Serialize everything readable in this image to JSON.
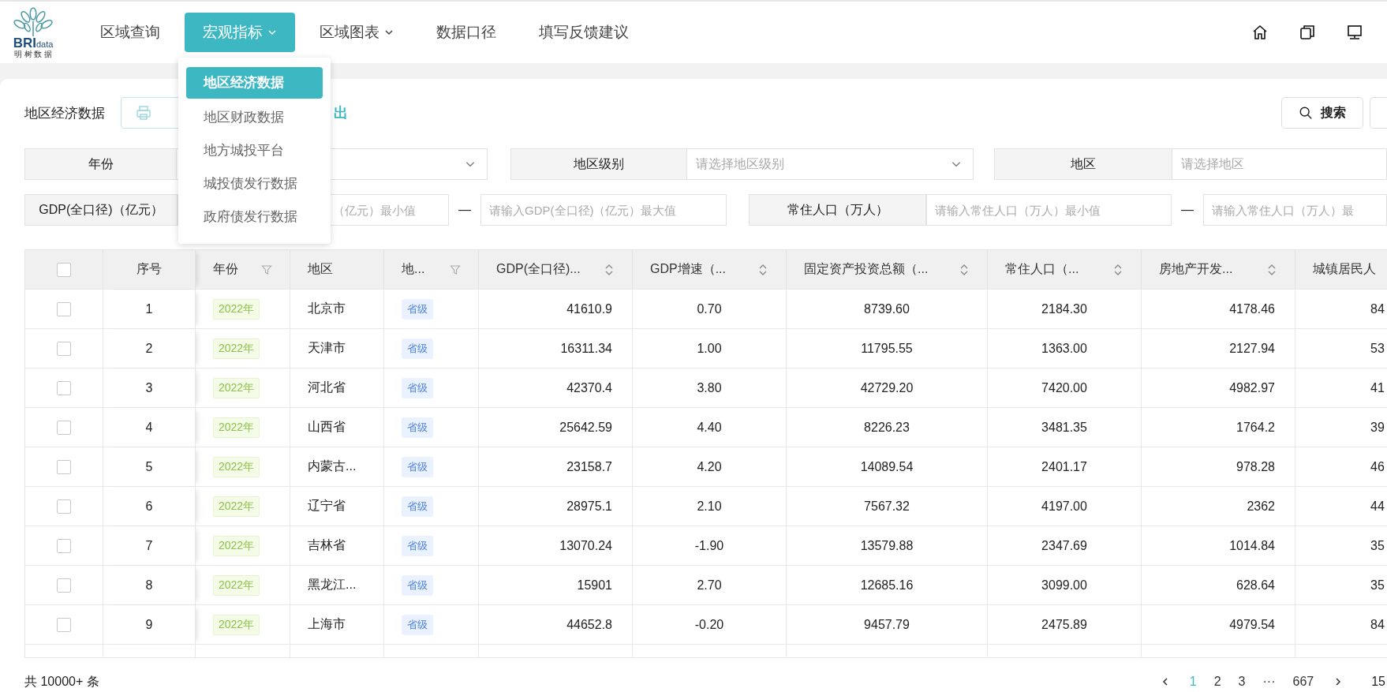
{
  "logo": {
    "mark": "BRI",
    "suffix": "data",
    "tagline": "明 树 数 据"
  },
  "nav": {
    "items": [
      {
        "label": "区域查询",
        "selected": false,
        "caret": false
      },
      {
        "label": "宏观指标",
        "selected": true,
        "caret": true
      },
      {
        "label": "区域图表",
        "selected": false,
        "caret": true
      },
      {
        "label": "数据口径",
        "selected": false,
        "caret": false
      },
      {
        "label": "填写反馈建议",
        "selected": false,
        "caret": false
      }
    ]
  },
  "dropdown": {
    "items": [
      {
        "label": "地区经济数据",
        "selected": true
      },
      {
        "label": "地区财政数据",
        "selected": false
      },
      {
        "label": "地方城投平台",
        "selected": false
      },
      {
        "label": "城投债发行数据",
        "selected": false
      },
      {
        "label": "政府债发行数据",
        "selected": false
      }
    ]
  },
  "toolbar": {
    "title": "地区经济数据",
    "export_label": "出",
    "search_label": "搜索"
  },
  "filters": {
    "year_label": "年份",
    "level_label": "地区级别",
    "level_placeholder": "请选择地区级别",
    "region_label": "地区",
    "region_placeholder": "请选择地区",
    "gdp_label": "GDP(全口径)（亿元）",
    "gdp_min_placeholder": "（亿元）最小值",
    "gdp_max_placeholder": "请输入GDP(全口径)（亿元）最大值",
    "pop_label": "常住人口（万人）",
    "pop_min_placeholder": "请输入常住人口（万人）最小值",
    "pop_max_placeholder": "请输入常住人口（万人）最",
    "dash": "—"
  },
  "table": {
    "header_checked": false,
    "columns": [
      {
        "label": "序号",
        "kind": "plain"
      },
      {
        "label": "年份",
        "kind": "filterable"
      },
      {
        "label": "地区",
        "kind": "plain"
      },
      {
        "label": "地...",
        "kind": "filterable"
      },
      {
        "label": "GDP(全口径)...",
        "kind": "sortable"
      },
      {
        "label": "GDP增速（...",
        "kind": "sortable"
      },
      {
        "label": "固定资产投资总额（...",
        "kind": "sortable"
      },
      {
        "label": "常住人口（...",
        "kind": "sortable"
      },
      {
        "label": "房地产开发...",
        "kind": "sortable"
      },
      {
        "label": "城镇居民人",
        "kind": "plain"
      }
    ],
    "rows": [
      {
        "checked": false,
        "cells": [
          "1",
          "2022年",
          "北京市",
          "省级",
          "41610.9",
          "0.70",
          "8739.60",
          "2184.30",
          "4178.46",
          "84"
        ]
      },
      {
        "checked": false,
        "cells": [
          "2",
          "2022年",
          "天津市",
          "省级",
          "16311.34",
          "1.00",
          "11795.55",
          "1363.00",
          "2127.94",
          "53"
        ]
      },
      {
        "checked": false,
        "cells": [
          "3",
          "2022年",
          "河北省",
          "省级",
          "42370.4",
          "3.80",
          "42729.20",
          "7420.00",
          "4982.97",
          "41"
        ]
      },
      {
        "checked": false,
        "cells": [
          "4",
          "2022年",
          "山西省",
          "省级",
          "25642.59",
          "4.40",
          "8226.23",
          "3481.35",
          "1764.2",
          "39"
        ]
      },
      {
        "checked": false,
        "cells": [
          "5",
          "2022年",
          "内蒙古...",
          "省级",
          "23158.7",
          "4.20",
          "14089.54",
          "2401.17",
          "978.28",
          "46"
        ]
      },
      {
        "checked": false,
        "cells": [
          "6",
          "2022年",
          "辽宁省",
          "省级",
          "28975.1",
          "2.10",
          "7567.32",
          "4197.00",
          "2362",
          "44"
        ]
      },
      {
        "checked": false,
        "cells": [
          "7",
          "2022年",
          "吉林省",
          "省级",
          "13070.24",
          "-1.90",
          "13579.88",
          "2347.69",
          "1014.84",
          "35"
        ]
      },
      {
        "checked": false,
        "cells": [
          "8",
          "2022年",
          "黑龙江...",
          "省级",
          "15901",
          "2.70",
          "12685.16",
          "3099.00",
          "628.64",
          "35"
        ]
      },
      {
        "checked": false,
        "cells": [
          "9",
          "2022年",
          "上海市",
          "省级",
          "44652.8",
          "-0.20",
          "9457.79",
          "2475.89",
          "4979.54",
          "84"
        ]
      }
    ]
  },
  "footer": {
    "total": "共 10000+ 条",
    "pages": [
      {
        "label": "1",
        "selected": true
      },
      {
        "label": "2",
        "selected": false
      },
      {
        "label": "3",
        "selected": false
      },
      {
        "label": "···",
        "selected": false
      },
      {
        "label": "667",
        "selected": false
      }
    ],
    "page_size": "15"
  }
}
